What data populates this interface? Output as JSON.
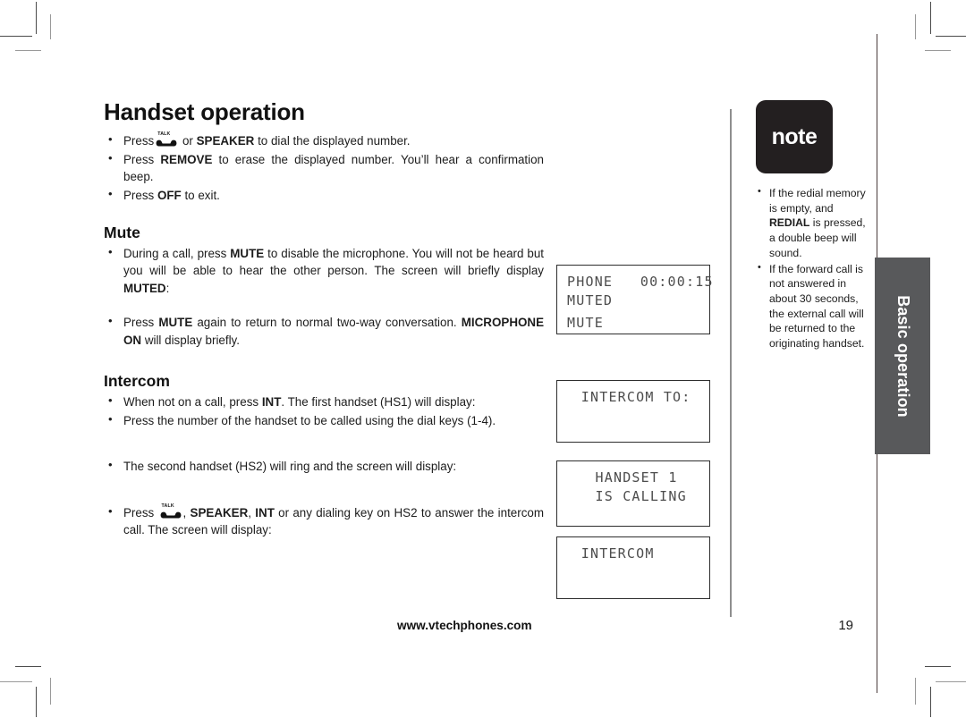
{
  "document": {
    "title": "Handset operation",
    "page_number": "19",
    "footer_url": "www.vtechphones.com",
    "side_tab_label": "Basic operation",
    "note_badge_label": "note"
  },
  "intro_bullets": [
    {
      "icon": "talk-key-icon",
      "pre": "Press",
      "post": " or ",
      "bold": "SPEAKER",
      "tail": " to dial the displayed number."
    },
    {
      "text_html": "Press <b>REMOVE</b> to erase the displayed number. You’ll hear a confirmation beep."
    },
    {
      "text_html": "Press <b>OFF</b> to exit."
    }
  ],
  "sections": [
    {
      "heading": "Mute",
      "bullets": [
        {
          "text_html": "During a call, press <b>MUTE</b> to disable the microphone. You will not be heard but you will be able to hear the other person. The screen will briefly display <b>MUTED</b>:"
        },
        {
          "text_html": "Press <b>MUTE</b> again to return to normal two-way conversation. <b>MICROPHONE ON</b> will display briefly."
        }
      ]
    },
    {
      "heading": "Intercom",
      "bullets": [
        {
          "text_html": "When not on a call, press <b>INT</b>. The first handset (HS1) will display:"
        },
        {
          "text_html": "Press the number of the handset to be called using the dial keys (1-4)."
        },
        {
          "text_html": "The second handset (HS2) will ring and the screen will display:"
        },
        {
          "text_html": "Press <span class=\"talk-slot\"></span>, <b>SPEAKER</b>, <b>INT</b> or any dialing key on HS2 to answer the intercom call. The screen will display:"
        }
      ]
    }
  ],
  "lcd_screens": [
    {
      "id": "lcd-mute",
      "lines": [
        {
          "text": "PHONE   00:00:15",
          "indent": 0
        },
        {
          "text": "MUTED",
          "indent": 0
        },
        {
          "text": "",
          "indent": 0
        },
        {
          "text": "MUTE",
          "indent": 0
        }
      ]
    },
    {
      "id": "lcd-intercom-to",
      "lines": [
        {
          "text": "INTERCOM TO:",
          "indent": 1
        },
        {
          "text": "",
          "indent": 0
        },
        {
          "text": "",
          "indent": 0
        }
      ]
    },
    {
      "id": "lcd-handset-calling",
      "lines": [
        {
          "text": "HANDSET 1",
          "indent": 2
        },
        {
          "text": "IS CALLING",
          "indent": 2
        },
        {
          "text": "",
          "indent": 0
        }
      ]
    },
    {
      "id": "lcd-intercom",
      "lines": [
        {
          "text": "INTERCOM",
          "indent": 1
        },
        {
          "text": "",
          "indent": 0
        },
        {
          "text": "",
          "indent": 0
        }
      ]
    }
  ],
  "note_bullets": [
    {
      "text_html": "If the redial memory is empty, and <b>REDIAL</b> is pressed, a double beep will sound."
    },
    {
      "text_html": "If the forward call is not answered in about 30 seconds, the external call will be returned to the originating handset."
    }
  ],
  "colors": {
    "note_badge_bg": "#231f20",
    "side_tab_bg": "#58595b",
    "lcd_border": "#2d2d2d",
    "lcd_text": "#4d4d4d",
    "divider": "#8e8e8e",
    "body_text": "#1c1c1c"
  }
}
